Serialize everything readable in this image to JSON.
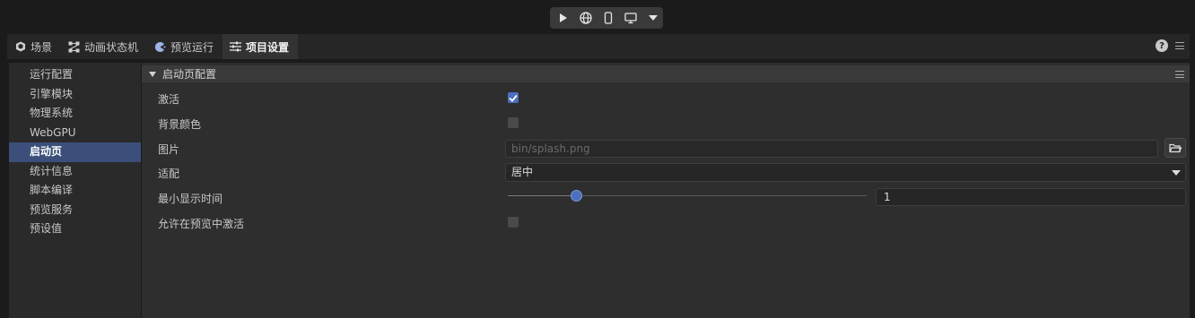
{
  "toolbar": {
    "buttons": [
      "play-icon",
      "globe-icon",
      "phone-icon",
      "monitor-icon",
      "chevron-down-icon"
    ]
  },
  "tabs": [
    {
      "label": "场景",
      "icon": "scene-icon",
      "active": false
    },
    {
      "label": "动画状态机",
      "icon": "state-machine-icon",
      "active": false
    },
    {
      "label": "预览运行",
      "icon": "preview-icon",
      "active": false
    },
    {
      "label": "项目设置",
      "icon": "settings-sliders-icon",
      "active": true
    }
  ],
  "sidebar": {
    "items": [
      {
        "label": "运行配置"
      },
      {
        "label": "引擎模块"
      },
      {
        "label": "物理系统"
      },
      {
        "label": "WebGPU"
      },
      {
        "label": "启动页",
        "active": true
      },
      {
        "label": "统计信息"
      },
      {
        "label": "脚本编译"
      },
      {
        "label": "预览服务"
      },
      {
        "label": "预设值"
      }
    ]
  },
  "section": {
    "title": "启动页配置",
    "fields": {
      "activate": {
        "label": "激活",
        "checked": true
      },
      "bg_color": {
        "label": "背景颜色",
        "checked": false
      },
      "image": {
        "label": "图片",
        "value": "bin/splash.png"
      },
      "fit": {
        "label": "适配",
        "value": "居中"
      },
      "min_time": {
        "label": "最小显示时间",
        "value": "1",
        "slider_fraction": 0.19
      },
      "preview": {
        "label": "允许在预览中激活",
        "checked": false
      }
    }
  },
  "colors": {
    "accent": "#4c6fbf",
    "active_sidebar": "#3b4f7a",
    "panel": "#2e2e2e"
  }
}
